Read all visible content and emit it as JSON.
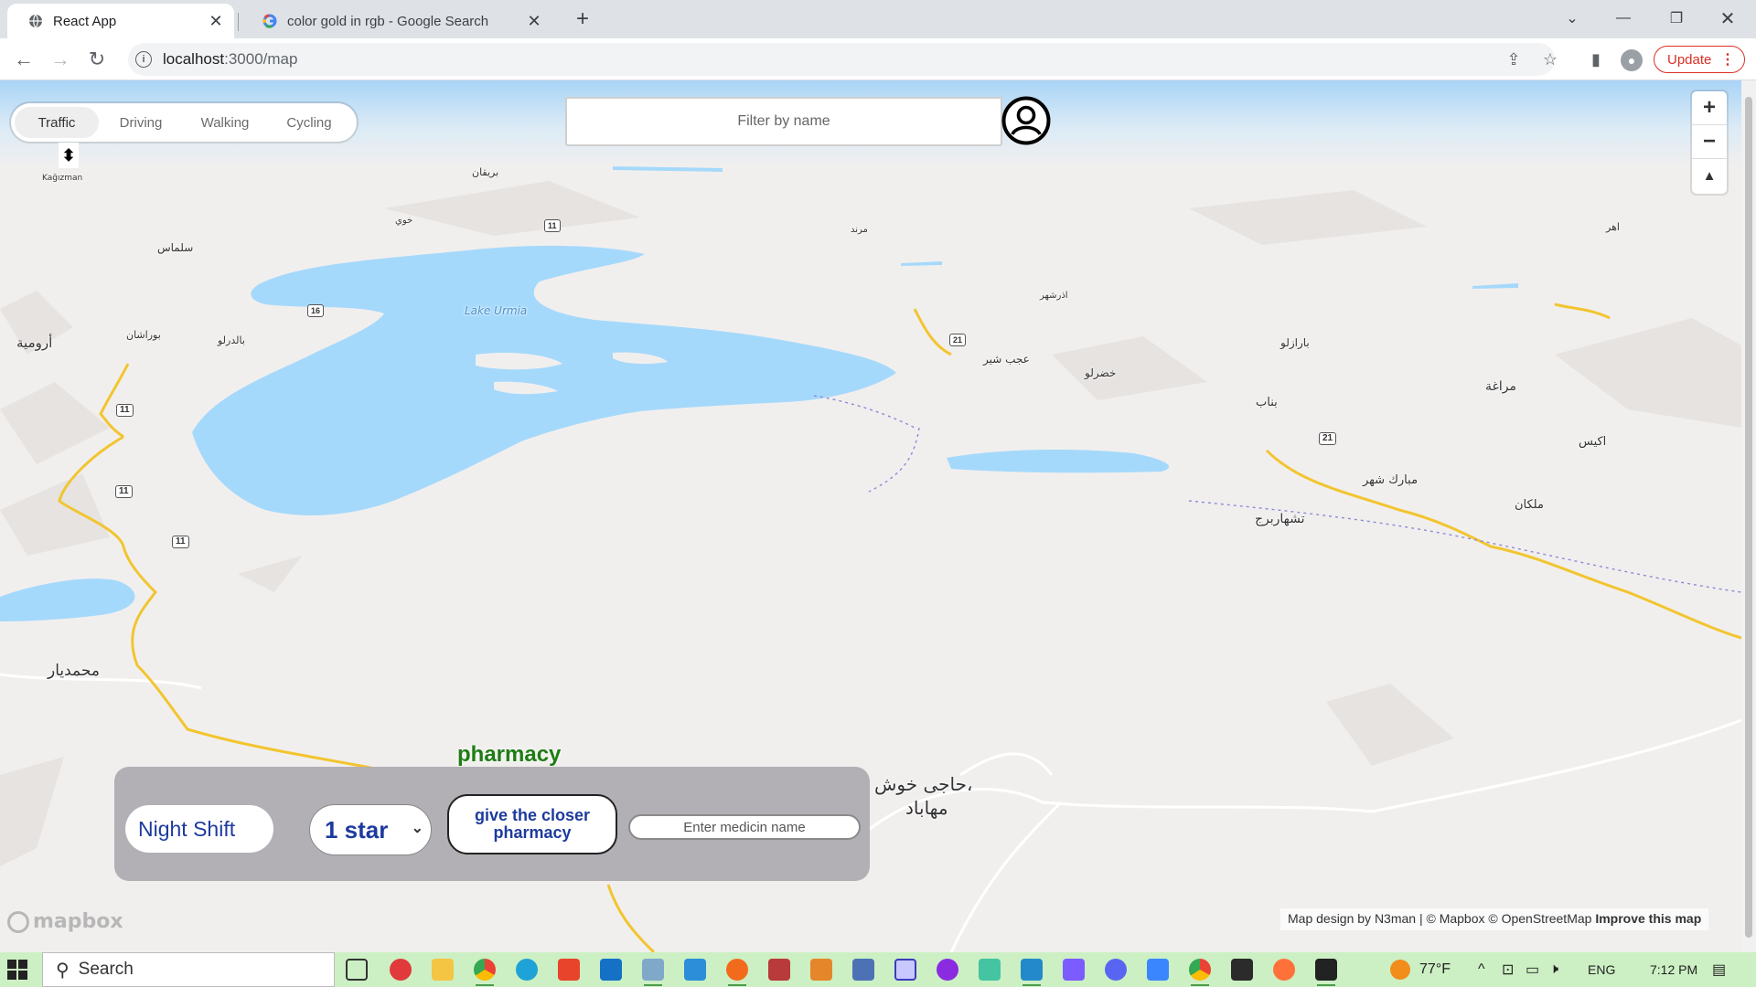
{
  "browser": {
    "tabs": [
      {
        "title": "React App",
        "active": true,
        "favicon": "globe-icon"
      },
      {
        "title": "color gold in rgb - Google Search",
        "active": false,
        "favicon": "google-icon"
      }
    ],
    "new_tab": "+",
    "url_host": "localhost",
    "url_path": ":3000/map",
    "update_label": "Update"
  },
  "map": {
    "mode_tabs": [
      "Traffic",
      "Driving",
      "Walking",
      "Cycling"
    ],
    "active_mode": "Traffic",
    "filter_placeholder": "Filter by name",
    "zoom_in": "+",
    "zoom_out": "−",
    "compass": "▲",
    "tilt_icon": "⬍",
    "lake_label": "Lake Urmia",
    "places": [
      {
        "name": "أرومية",
        "size": 15
      },
      {
        "name": "محمديار",
        "size": 17
      },
      {
        "name": "سلماس",
        "size": 12
      },
      {
        "name": "بوراشان",
        "size": 11
      },
      {
        "name": "بالدرلو",
        "size": 11
      },
      {
        "name": "عجب شير",
        "size": 12
      },
      {
        "name": "خضرلو",
        "size": 12
      },
      {
        "name": "بناب",
        "size": 13
      },
      {
        "name": "مراغة",
        "size": 14
      },
      {
        "name": "بارازلو",
        "size": 12
      },
      {
        "name": "اكيس",
        "size": 13
      },
      {
        "name": "مبارك شهر",
        "size": 13
      },
      {
        "name": "ملكان",
        "size": 13
      },
      {
        "name": "تشهاربرج",
        "size": 14
      },
      {
        "name": "اذرشهر",
        "size": 10
      },
      {
        "name": "حاجی خوش،",
        "size": 20
      },
      {
        "name": "مهاباد",
        "size": 20
      },
      {
        "name": "Kağızman",
        "size": 9
      },
      {
        "name": "اهر",
        "size": 11
      },
      {
        "name": "بريقان",
        "size": 11
      },
      {
        "name": "خوي",
        "size": 10
      },
      {
        "name": "مرند",
        "size": 10
      }
    ],
    "pharmacy_label": "pharmacy",
    "attribution": {
      "text": "Map design by N3man | © Mapbox © OpenStreetMap",
      "improve": "Improve this map"
    },
    "mapbox_logo": "mapbox",
    "colors": {
      "water": "#a5d9fb",
      "road": "#f2c530",
      "land": "#f1efee",
      "accent_green": "#1e7d13",
      "panel": "#b2afb5",
      "text_blue": "#1d3b9e"
    }
  },
  "panel": {
    "night_shift": "Night Shift",
    "stars_selected": "1 star",
    "closer_button": "give the closer pharmacy",
    "medicine_placeholder": "Enter medicin name"
  },
  "taskbar": {
    "search_label": "Search",
    "weather": "77°F",
    "language": "ENG",
    "time": "7:12 PM"
  }
}
